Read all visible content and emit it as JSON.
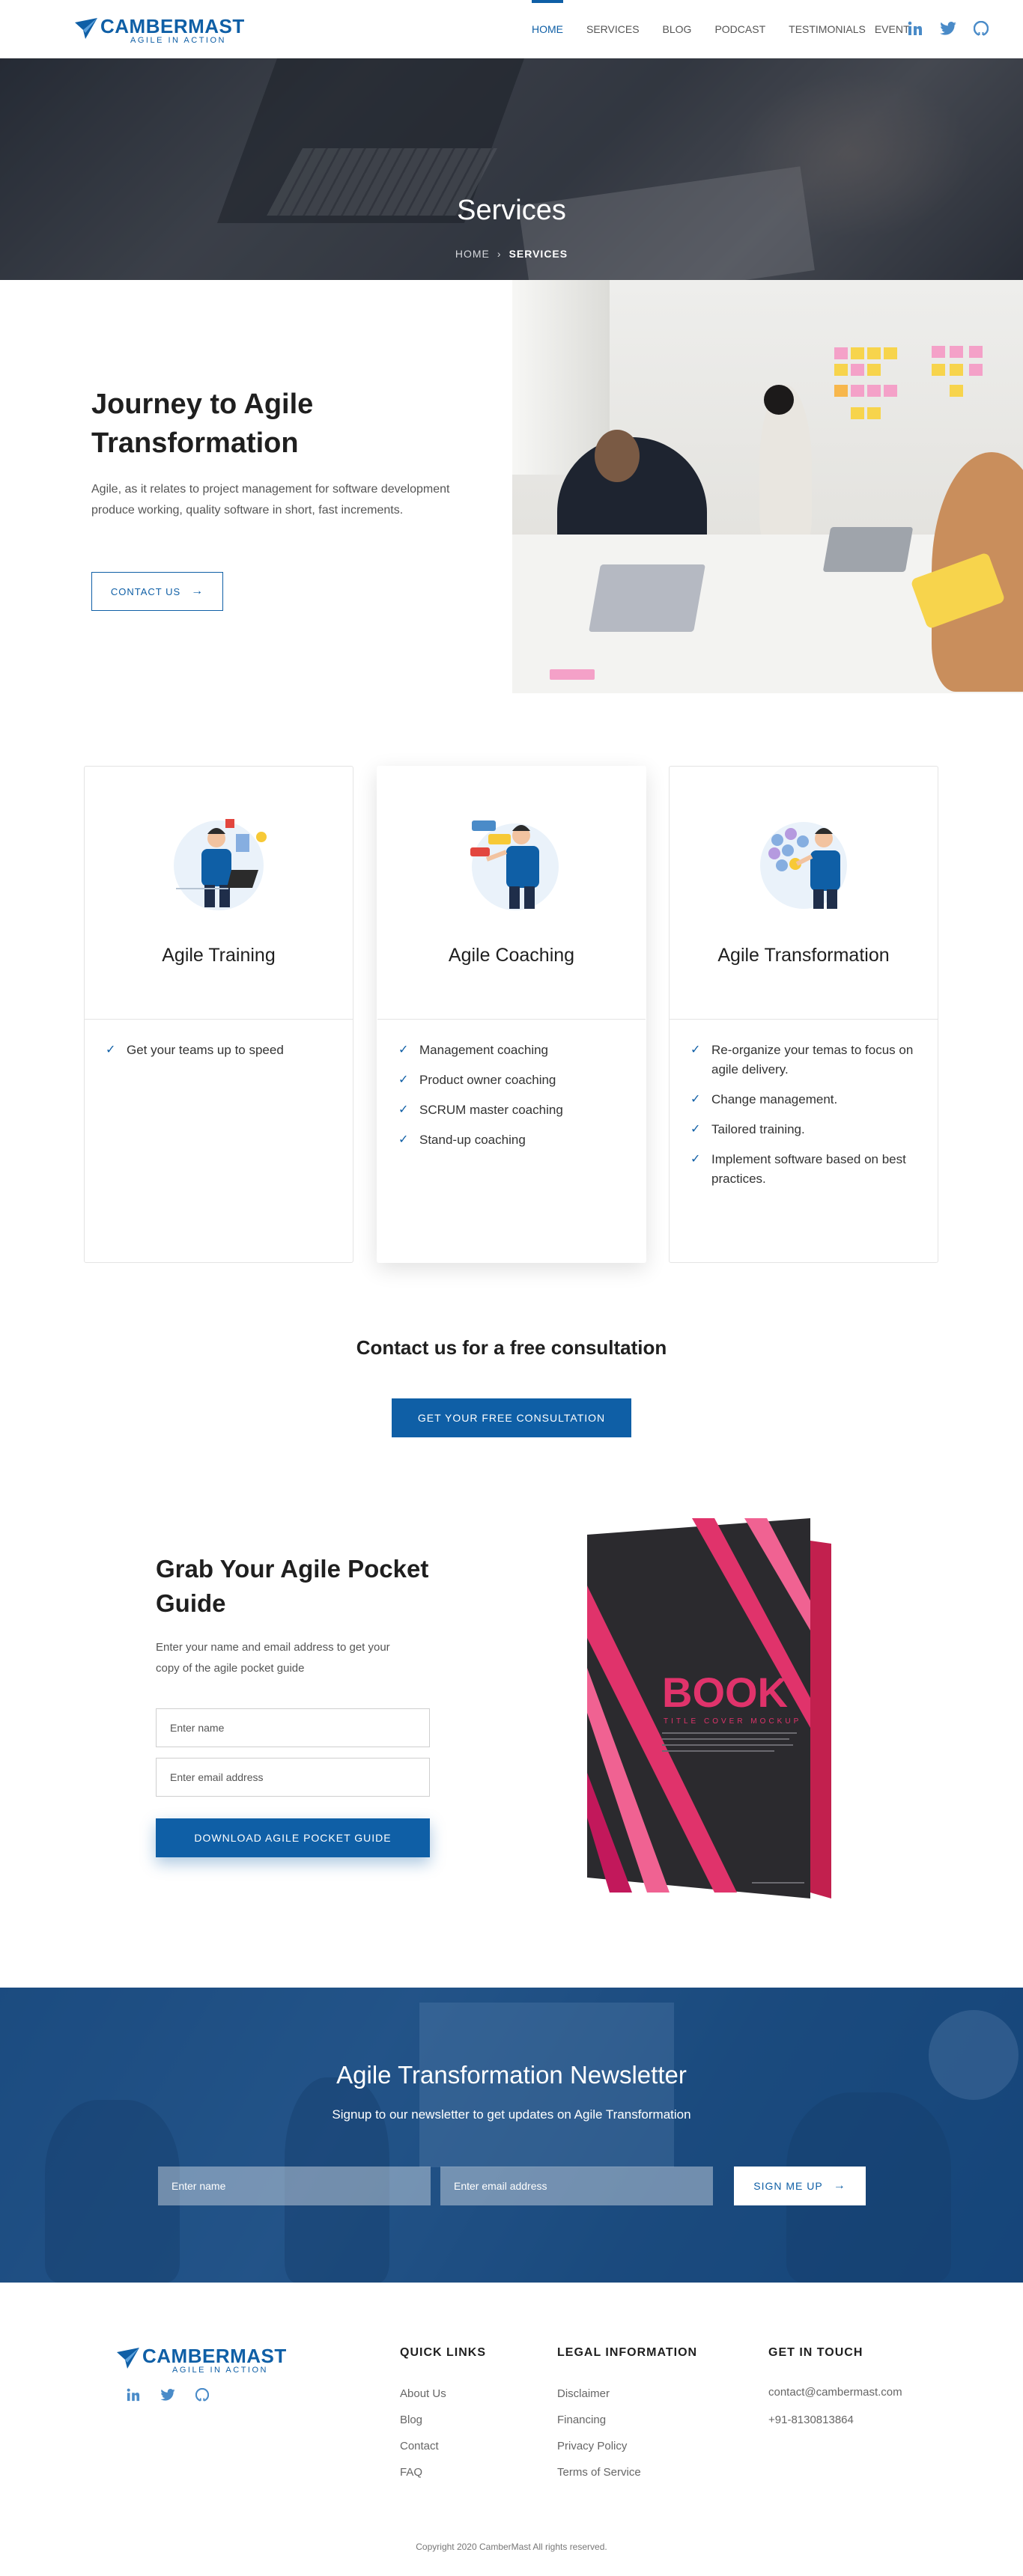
{
  "brand": {
    "name": "CAMBERMAST",
    "tagline": "AGILE IN ACTION",
    "color": "#0f5fa6"
  },
  "nav": {
    "items": [
      {
        "label": "HOME",
        "active": true
      },
      {
        "label": "SERVICES",
        "active": false
      },
      {
        "label": "BLOG",
        "active": false
      },
      {
        "label": "PODCAST",
        "active": false
      },
      {
        "label": "TESTIMONIALS",
        "active": false
      },
      {
        "label": "EVENT",
        "active": false
      }
    ],
    "social": [
      "linkedin-icon",
      "twitter-icon",
      "github-icon"
    ]
  },
  "hero": {
    "title": "Services",
    "breadcrumb": {
      "home": "HOME",
      "separator": "›",
      "current": "SERVICES"
    }
  },
  "journey": {
    "title": "Journey to Agile Transformation",
    "text": "Agile, as it relates to project management for software development produce working, quality software in short, fast increments.",
    "button": "CONTACT US"
  },
  "services": [
    {
      "title": "Agile Training",
      "items": [
        "Get your teams up to speed"
      ]
    },
    {
      "title": "Agile Coaching",
      "items": [
        "Management coaching",
        "Product owner coaching",
        "SCRUM master coaching",
        "Stand-up coaching"
      ]
    },
    {
      "title": "Agile Transformation",
      "items": [
        "Re-organize your temas to focus on agile delivery.",
        "Change management.",
        "Tailored training.",
        "Implement software based on best practices."
      ]
    }
  ],
  "consult": {
    "title": "Contact us for a free consultation",
    "button": "GET YOUR FREE CONSULTATION"
  },
  "guide": {
    "title": "Grab Your Agile Pocket Guide",
    "text": "Enter your name and email address to get your copy of the agile pocket guide",
    "name_placeholder": "Enter name",
    "email_placeholder": "Enter email address",
    "button": "DOWNLOAD AGILE POCKET GUIDE",
    "book": {
      "title": "BOOK",
      "subtitle": "TITLE COVER MOCKUP"
    }
  },
  "newsletter": {
    "title": "Agile Transformation Newsletter",
    "subtitle": "Signup to our newsletter to get updates on Agile Transformation",
    "name_placeholder": "Enter name",
    "email_placeholder": "Enter email address",
    "button": "SIGN ME UP"
  },
  "footer": {
    "quick_links": {
      "heading": "QUICK LINKS",
      "links": [
        "About Us",
        "Blog",
        "Contact",
        "FAQ"
      ]
    },
    "legal": {
      "heading": "LEGAL INFORMATION",
      "links": [
        "Disclaimer",
        "Financing",
        "Privacy Policy",
        "Terms of Service"
      ]
    },
    "contact": {
      "heading": "GET IN TOUCH",
      "email": "contact@cambermast.com",
      "phone": "+91-8130813864"
    },
    "copyright": "Copyright 2020 CamberMast All rights reserved."
  }
}
